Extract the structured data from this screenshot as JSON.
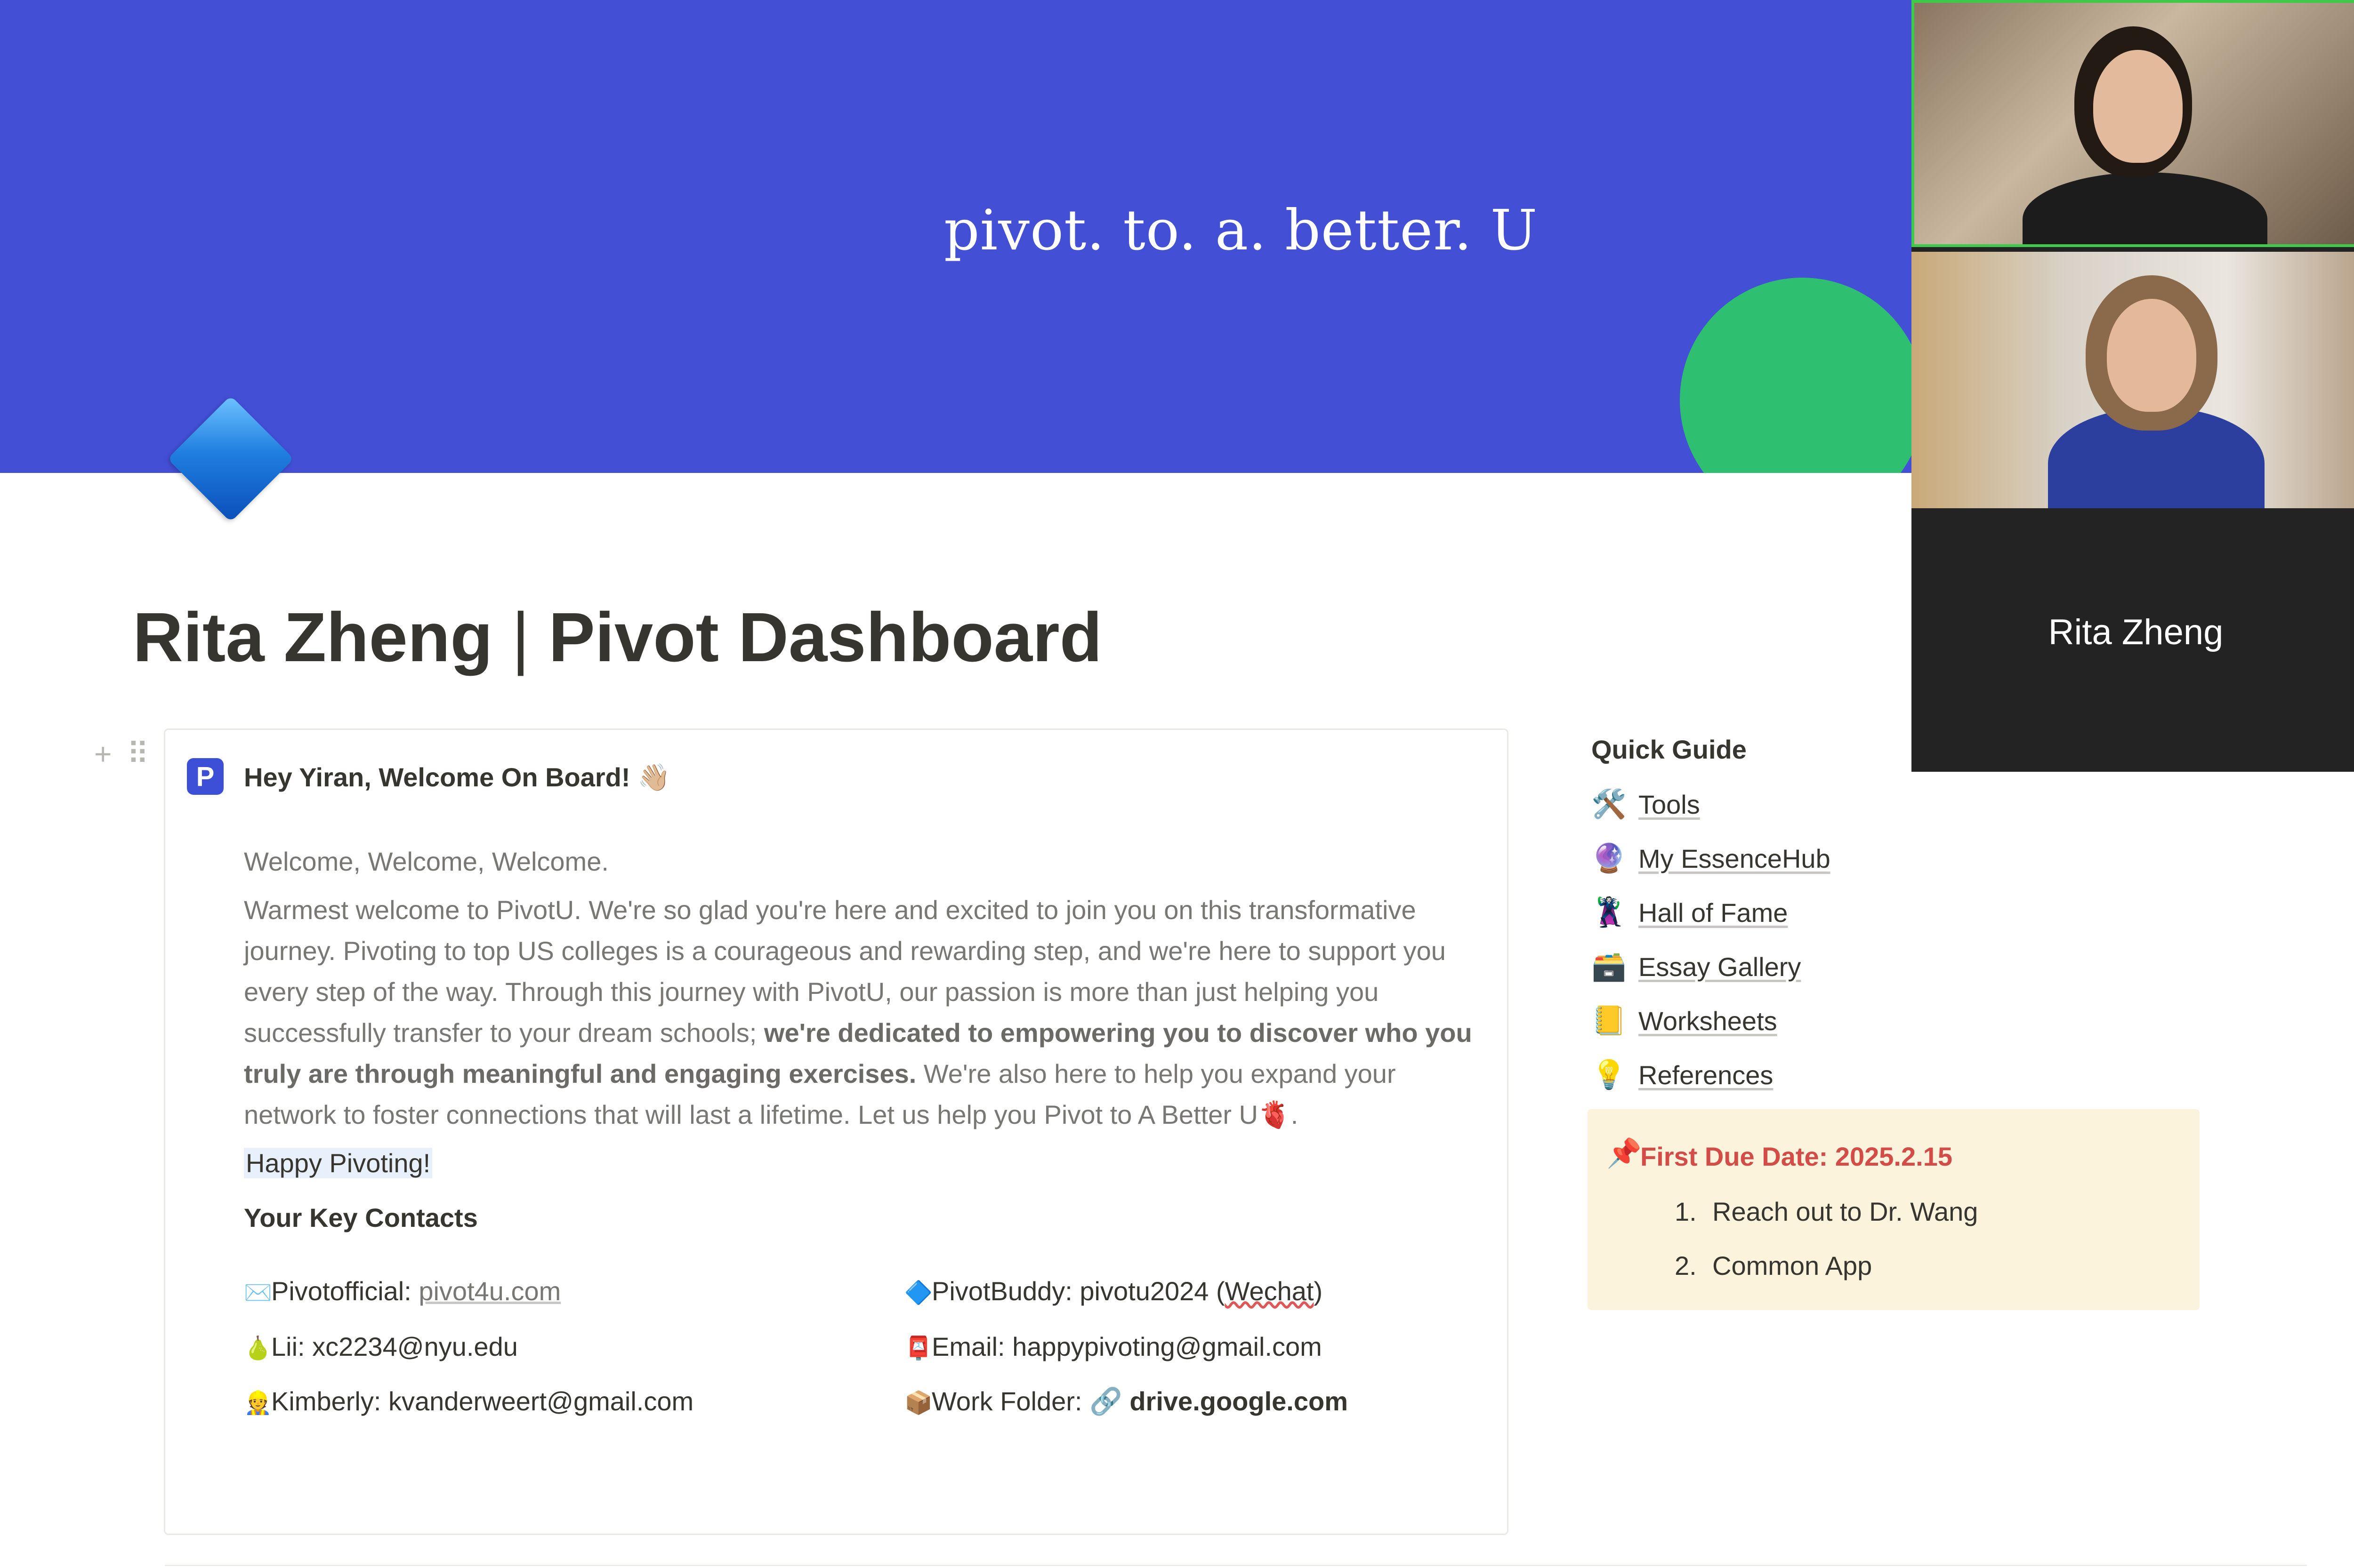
{
  "banner": {
    "title": "pivot. to. a. better. U"
  },
  "page": {
    "title_left": "Rita Zheng",
    "title_sep": "|",
    "title_right": "Pivot Dashboard"
  },
  "block_handles": {
    "add": "+",
    "drag": "⠿"
  },
  "callout": {
    "icon_glyph": "P",
    "heading": "Hey Yiran, Welcome On Board! 👋🏼",
    "intro": "Welcome, Welcome, Welcome.",
    "body_part1": "Warmest welcome to PivotU. We're so glad you're here and excited to join you on this transformative journey. Pivoting to top US colleges is a courageous and rewarding step, and we're here to support you every step of the way. Through this journey with PivotU, our passion is more than just helping you successfully transfer to your dream schools; ",
    "body_bold": "we're dedicated to empowering you to discover who you truly are through meaningful and engaging exercises.",
    "body_part2": " We're also here to help you expand your network to foster connections that will last a lifetime. Let us help you Pivot to A Better U",
    "body_heart": "🫀",
    "body_end": ".",
    "happy": "Happy Pivoting!",
    "contacts_title": "Your Key Contacts",
    "contacts": {
      "official_icon": "✉️",
      "official_label": "Pivotofficial: ",
      "official_link": "pivot4u.com",
      "buddy_icon": "🔷",
      "buddy_label": "PivotBuddy: pivotu2024 (",
      "buddy_wavy": "Wechat",
      "buddy_end": ")",
      "lii_icon": "🍐",
      "lii_text": "Lii: xc2234@nyu.edu",
      "email_icon": "📮",
      "email_text": "Email: happypivoting@gmail.com",
      "kimberly_icon": "👷",
      "kimberly_text": "Kimberly: kvanderweert@gmail.com",
      "folder_icon": "📦",
      "folder_label": "Work Folder: ",
      "folder_link_icon": "🔗",
      "folder_link": "drive.google.com"
    }
  },
  "quick_guide": {
    "title": "Quick Guide",
    "items": [
      {
        "icon": "🛠️",
        "label": "Tools"
      },
      {
        "icon": "🔮",
        "label": "My EssenceHub"
      },
      {
        "icon": "🦹",
        "label": "Hall of Fame"
      },
      {
        "icon": "🗃️",
        "label": "Essay Gallery"
      },
      {
        "icon": "📒",
        "label": "Worksheets"
      },
      {
        "icon": "💡",
        "label": "References"
      }
    ]
  },
  "due": {
    "pin": "📌",
    "title": "First Due Date: 2025.2.15",
    "items": [
      {
        "num": "1.",
        "text": "Reach out to Dr. Wang"
      },
      {
        "num": "2.",
        "text": "Common App"
      }
    ]
  },
  "video": {
    "name": "Rita Zheng"
  }
}
